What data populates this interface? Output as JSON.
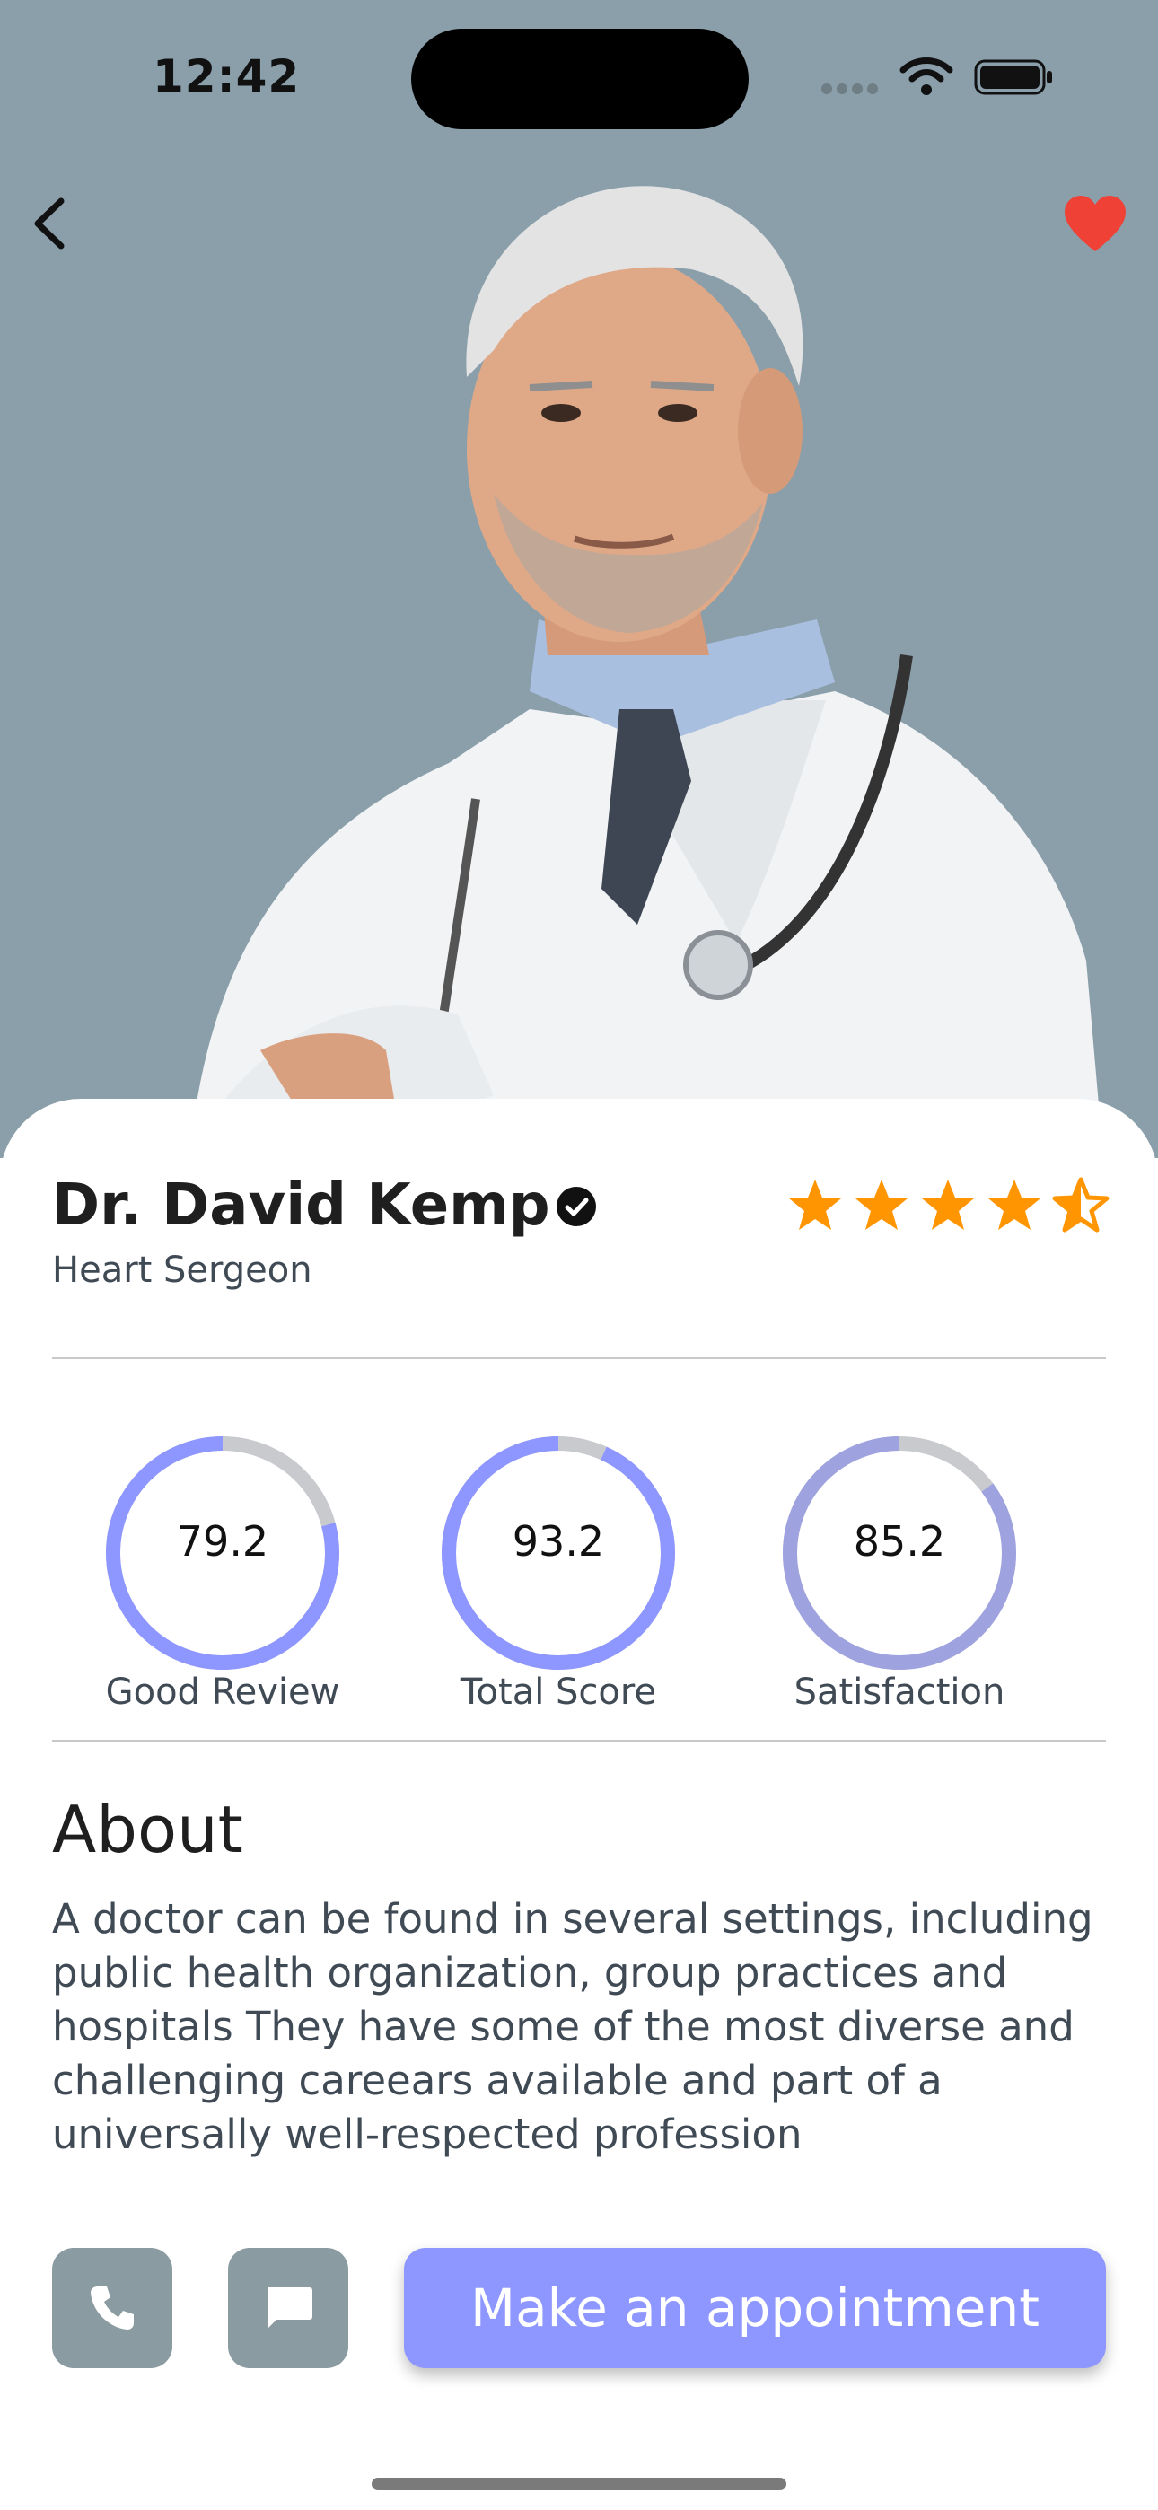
{
  "status_bar": {
    "time": "12:42"
  },
  "header": {
    "back_icon": "chevron-left-icon",
    "favorite_icon": "heart-icon",
    "favorite_color": "#ef4136"
  },
  "doctor": {
    "name": "Dr. David Kemp",
    "specialty": "Heart Sergeon",
    "verified": true,
    "rating": 4.5,
    "rating_max": 5
  },
  "stats": [
    {
      "value": "79.2",
      "label": "Good Review",
      "fraction": 0.792
    },
    {
      "value": "93.2",
      "label": "Total Score",
      "fraction": 0.932
    },
    {
      "value": "85.2",
      "label": "Satisfaction",
      "fraction": 0.852
    }
  ],
  "about": {
    "title": "About",
    "text": "A doctor can be found in several settings, including public health organization, group practices and  hospitals They have some of the most diverse and challenging careears available and part of a universally well-respected profession"
  },
  "actions": {
    "call_icon": "phone-icon",
    "message_icon": "chat-icon",
    "appointment_label": "Make an appointment"
  },
  "colors": {
    "hero_bg": "#8a9faa",
    "accent": "#8e96ff",
    "star": "#ff9500",
    "icon_button_bg": "#8b9ba2"
  }
}
